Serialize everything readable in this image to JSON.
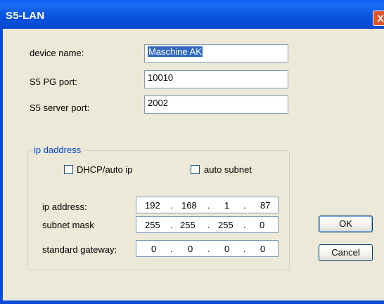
{
  "window": {
    "title": "S5-LAN",
    "close_glyph": "X"
  },
  "fields": {
    "device_name": {
      "label": "device name:",
      "value": "Maschine AK"
    },
    "s5_pg_port": {
      "label": "S5 PG port:",
      "value": "10010"
    },
    "s5_server_port": {
      "label": "S5 server port:",
      "value": "2002"
    }
  },
  "ip_group": {
    "title": "ip daddress",
    "dhcp": {
      "label": "DHCP/auto ip",
      "checked": false
    },
    "auto_subnet": {
      "label": "auto subnet",
      "checked": false
    },
    "ip_address": {
      "label": "ip address:",
      "octets": [
        "192",
        "168",
        "1",
        "87"
      ]
    },
    "subnet_mask": {
      "label": "subnet mask",
      "octets": [
        "255",
        "255",
        "255",
        "0"
      ]
    },
    "standard_gateway": {
      "label": "standard gateway:",
      "octets": [
        "0",
        "0",
        "0",
        "0"
      ]
    },
    "separator": "."
  },
  "buttons": {
    "ok": "OK",
    "cancel": "Cancel"
  }
}
